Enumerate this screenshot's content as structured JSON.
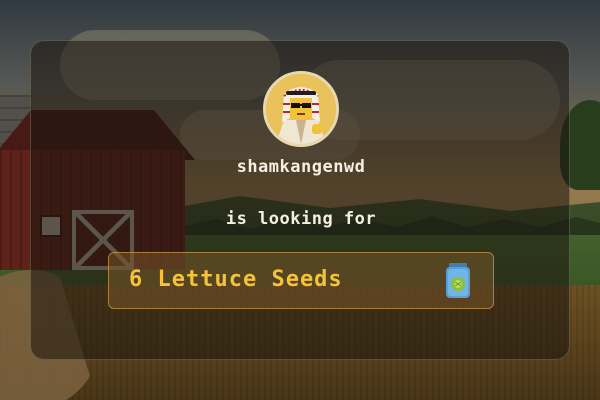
{
  "request": {
    "username": "shamkangenwd",
    "subtitle": "is looking for",
    "item_label": "6 Lettuce Seeds"
  },
  "icons": {
    "avatar": "avatar-icon",
    "item": "seed-packet-icon"
  },
  "colors": {
    "item_text": "#f6c23b",
    "text": "#f4efe2",
    "item_box_border": "#d6a050"
  }
}
